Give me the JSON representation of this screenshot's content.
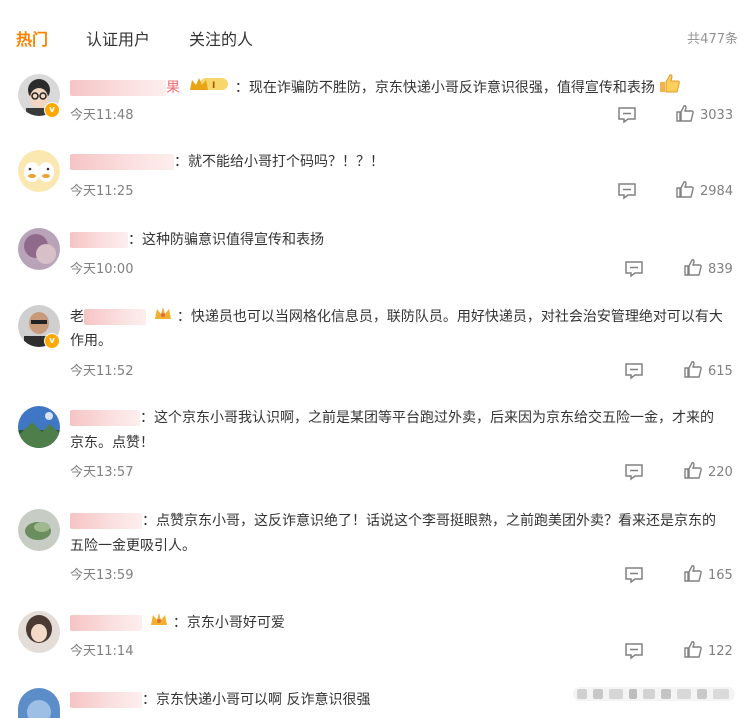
{
  "tabs": {
    "hot": "热门",
    "verified": "认证用户",
    "following": "关注的人"
  },
  "total": "共477条",
  "comments": [
    {
      "avatar": "avatar-glasses",
      "text": "：现在诈骗防不胜防，京东快递小哥反诈意识很强，值得宣传和表扬",
      "name_visible": "果",
      "time": "今天11:48",
      "likes": "3033",
      "verified": true
    },
    {
      "avatar": "avatar-duck",
      "text": "：就不能给小哥打个码吗？！？！",
      "time": "今天11:25",
      "likes": "2984"
    },
    {
      "avatar": "avatar-purple",
      "text": "：这种防骗意识值得宣传和表扬",
      "time": "今天10:00",
      "likes": "839"
    },
    {
      "avatar": "avatar-man",
      "name_visible": "老",
      "text": "：快递员也可以当网格化信息员，联防队员。用好快递员，对社会治安管理绝对可以有大",
      "text2": "作用。",
      "time": "今天11:52",
      "likes": "615",
      "verified": true
    },
    {
      "avatar": "avatar-mountain",
      "text": "：这个京东小哥我认识啊，之前是某团等平台跑过外卖，后来因为京东给交五险一金，才来的",
      "text2": "京东。点赞！",
      "time": "今天13:57",
      "likes": "220"
    },
    {
      "avatar": "avatar-plant",
      "text": "：点赞京东小哥，这反诈意识绝了！话说这个李哥挺眼熟，之前跑美团外卖？看来还是京东的",
      "text2": "五险一金更吸引人。",
      "time": "今天13:59",
      "likes": "165"
    },
    {
      "avatar": "avatar-girl",
      "text": "：京东小哥好可爱",
      "time": "今天11:14",
      "likes": "122"
    },
    {
      "avatar": "avatar-blue",
      "text": "：京东快递小哥可以啊 反诈意识很强"
    }
  ],
  "icons": {
    "reply": "comment-icon",
    "like": "thumb-up-icon",
    "crown": "crown-icon"
  },
  "colors": {
    "accent": "#ff8200",
    "text": "#333333",
    "meta": "#808080",
    "count": "#939393"
  }
}
